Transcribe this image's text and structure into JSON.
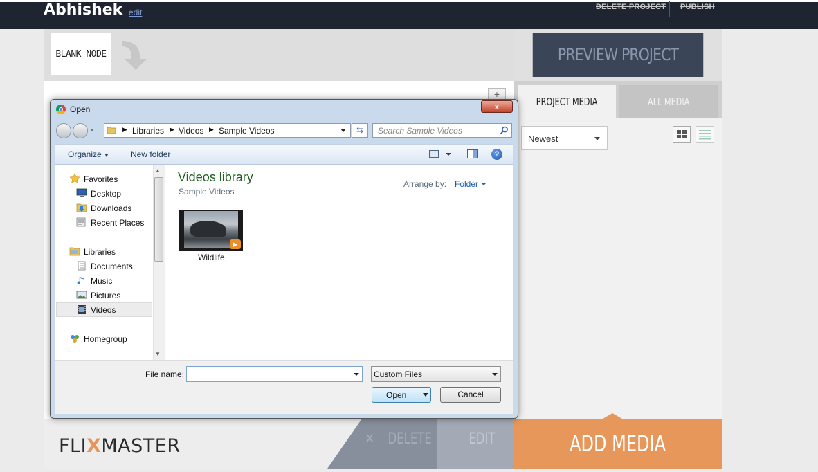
{
  "header": {
    "username": "Abhishek",
    "edit_label": "edit",
    "delete_project": "DELETE PROJECT",
    "publish": "PUBLISH"
  },
  "canvas": {
    "blank_node_label": "BLANK NODE",
    "add_button": "+"
  },
  "right_panel": {
    "preview_label": "PREVIEW PROJECT",
    "tabs": [
      {
        "label": "PROJECT MEDIA",
        "active": true
      },
      {
        "label": "ALL MEDIA",
        "active": false
      }
    ],
    "sort_value": "Newest"
  },
  "bottom": {
    "logo_left": "FLI",
    "logo_x": "X",
    "logo_right": "MASTER",
    "delete_label": "DELETE",
    "edit_label": "EDIT",
    "add_media_label": "ADD MEDIA"
  },
  "dialog": {
    "title": "Open",
    "close_glyph": "x",
    "address": [
      "Libraries",
      "Videos",
      "Sample Videos"
    ],
    "search_placeholder": "Search Sample Videos",
    "toolbar": {
      "organize": "Organize",
      "new_folder": "New folder",
      "help_glyph": "?"
    },
    "nav": {
      "favorites_header": "Favorites",
      "favorites": [
        "Desktop",
        "Downloads",
        "Recent Places"
      ],
      "libraries_header": "Libraries",
      "libraries": [
        "Documents",
        "Music",
        "Pictures",
        "Videos"
      ],
      "selected": "Videos",
      "homegroup": "Homegroup"
    },
    "library_title": "Videos library",
    "library_subtitle": "Sample Videos",
    "arrange_by_label": "Arrange by:",
    "arrange_by_value": "Folder",
    "files": [
      {
        "name": "Wildlife",
        "type": "video"
      }
    ],
    "file_name_label": "File name:",
    "file_name_value": "",
    "filter_value": "Custom Files",
    "open_label": "Open",
    "cancel_label": "Cancel"
  },
  "colors": {
    "top_bar": "#1f2530",
    "preview_button": "#3a4658",
    "add_media": "#e8975a",
    "library_title": "#1e5f1e"
  },
  "icons": [
    "chrome-icon",
    "close-icon",
    "back-icon",
    "forward-icon",
    "folder-icon",
    "refresh-icon",
    "search-icon",
    "star-icon",
    "desktop-icon",
    "downloads-icon",
    "recent-places-icon",
    "libraries-icon",
    "documents-icon",
    "music-icon",
    "pictures-icon",
    "videos-icon",
    "homegroup-icon",
    "help-icon",
    "grid-view-icon",
    "list-view-icon",
    "arrow-icon"
  ]
}
